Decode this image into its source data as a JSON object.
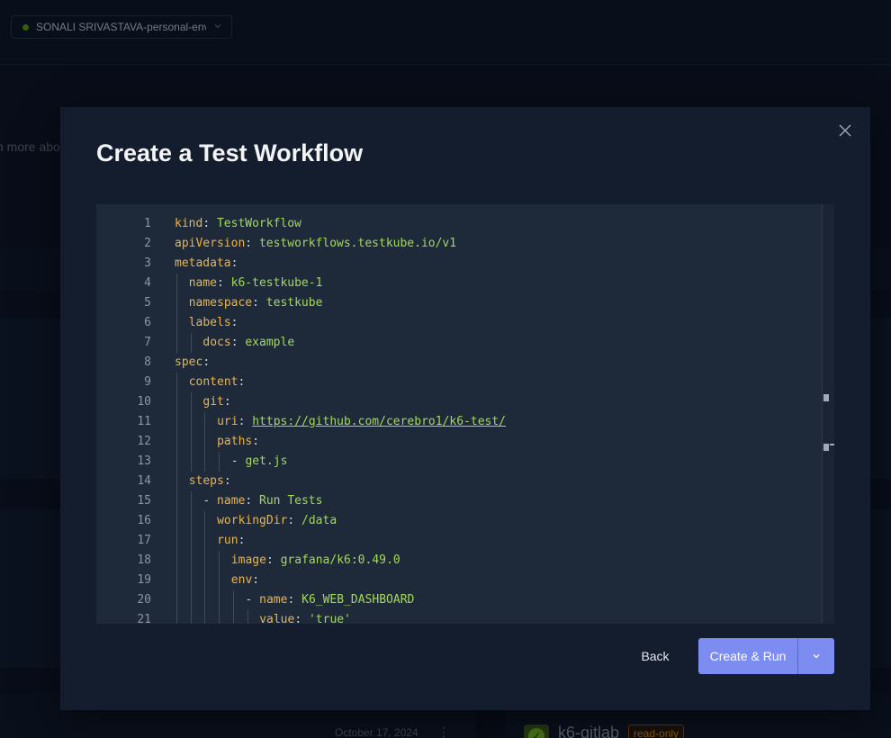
{
  "environment": {
    "label": "SONALI SRIVASTAVA-personal-env",
    "status_color": "#65a30d"
  },
  "background": {
    "learn_text": "n more abou",
    "date": "October 17, 2024",
    "workflow_name": "k6-gitlab",
    "badge": "read-only"
  },
  "modal": {
    "title": "Create a Test Workflow",
    "back_label": "Back",
    "primary_label": "Create & Run",
    "accent_color": "#7c8cf0"
  },
  "editor": {
    "lines": [
      {
        "n": "1",
        "indent": 0,
        "parts": [
          {
            "t": "kind",
            "c": "k"
          },
          {
            "t": ": ",
            "c": "p"
          },
          {
            "t": "TestWorkflow",
            "c": "s"
          }
        ]
      },
      {
        "n": "2",
        "indent": 0,
        "parts": [
          {
            "t": "apiVersion",
            "c": "k"
          },
          {
            "t": ": ",
            "c": "p"
          },
          {
            "t": "testworkflows.testkube.io/v1",
            "c": "s"
          }
        ]
      },
      {
        "n": "3",
        "indent": 0,
        "parts": [
          {
            "t": "metadata",
            "c": "k"
          },
          {
            "t": ":",
            "c": "p"
          }
        ]
      },
      {
        "n": "4",
        "indent": 1,
        "parts": [
          {
            "t": "name",
            "c": "k"
          },
          {
            "t": ": ",
            "c": "p"
          },
          {
            "t": "k6-testkube-1",
            "c": "s"
          }
        ]
      },
      {
        "n": "5",
        "indent": 1,
        "parts": [
          {
            "t": "namespace",
            "c": "k"
          },
          {
            "t": ": ",
            "c": "p"
          },
          {
            "t": "testkube",
            "c": "s"
          }
        ]
      },
      {
        "n": "6",
        "indent": 1,
        "parts": [
          {
            "t": "labels",
            "c": "k"
          },
          {
            "t": ":",
            "c": "p"
          }
        ]
      },
      {
        "n": "7",
        "indent": 2,
        "parts": [
          {
            "t": "docs",
            "c": "k"
          },
          {
            "t": ": ",
            "c": "p"
          },
          {
            "t": "example",
            "c": "s"
          }
        ]
      },
      {
        "n": "8",
        "indent": 0,
        "parts": [
          {
            "t": "spec",
            "c": "k"
          },
          {
            "t": ":",
            "c": "p"
          }
        ]
      },
      {
        "n": "9",
        "indent": 1,
        "parts": [
          {
            "t": "content",
            "c": "k"
          },
          {
            "t": ":",
            "c": "p"
          }
        ]
      },
      {
        "n": "10",
        "indent": 2,
        "parts": [
          {
            "t": "git",
            "c": "k"
          },
          {
            "t": ":",
            "c": "p"
          }
        ]
      },
      {
        "n": "11",
        "indent": 3,
        "parts": [
          {
            "t": "uri",
            "c": "k"
          },
          {
            "t": ": ",
            "c": "p"
          },
          {
            "t": "https://github.com/cerebro1/k6-test/",
            "c": "u"
          }
        ]
      },
      {
        "n": "12",
        "indent": 3,
        "parts": [
          {
            "t": "paths",
            "c": "k"
          },
          {
            "t": ":",
            "c": "p"
          }
        ]
      },
      {
        "n": "13",
        "indent": 4,
        "parts": [
          {
            "t": "- ",
            "c": "p"
          },
          {
            "t": "get.js",
            "c": "s"
          }
        ]
      },
      {
        "n": "14",
        "indent": 1,
        "parts": [
          {
            "t": "steps",
            "c": "k"
          },
          {
            "t": ":",
            "c": "p"
          }
        ]
      },
      {
        "n": "15",
        "indent": 2,
        "parts": [
          {
            "t": "- ",
            "c": "p"
          },
          {
            "t": "name",
            "c": "k"
          },
          {
            "t": ": ",
            "c": "p"
          },
          {
            "t": "Run Tests",
            "c": "s"
          }
        ]
      },
      {
        "n": "16",
        "indent": 3,
        "parts": [
          {
            "t": "workingDir",
            "c": "k"
          },
          {
            "t": ": ",
            "c": "p"
          },
          {
            "t": "/data",
            "c": "s"
          }
        ]
      },
      {
        "n": "17",
        "indent": 3,
        "parts": [
          {
            "t": "run",
            "c": "k"
          },
          {
            "t": ":",
            "c": "p"
          }
        ]
      },
      {
        "n": "18",
        "indent": 4,
        "parts": [
          {
            "t": "image",
            "c": "k"
          },
          {
            "t": ": ",
            "c": "p"
          },
          {
            "t": "grafana/k6:0.49.0",
            "c": "s"
          }
        ]
      },
      {
        "n": "19",
        "indent": 4,
        "parts": [
          {
            "t": "env",
            "c": "k"
          },
          {
            "t": ":",
            "c": "p"
          }
        ]
      },
      {
        "n": "20",
        "indent": 5,
        "parts": [
          {
            "t": "- ",
            "c": "p"
          },
          {
            "t": "name",
            "c": "k"
          },
          {
            "t": ": ",
            "c": "p"
          },
          {
            "t": "K6_WEB_DASHBOARD",
            "c": "s"
          }
        ]
      },
      {
        "n": "21",
        "indent": 6,
        "parts": [
          {
            "t": "value",
            "c": "k"
          },
          {
            "t": ": ",
            "c": "p"
          },
          {
            "t": "'true'",
            "c": "s"
          }
        ]
      }
    ]
  }
}
